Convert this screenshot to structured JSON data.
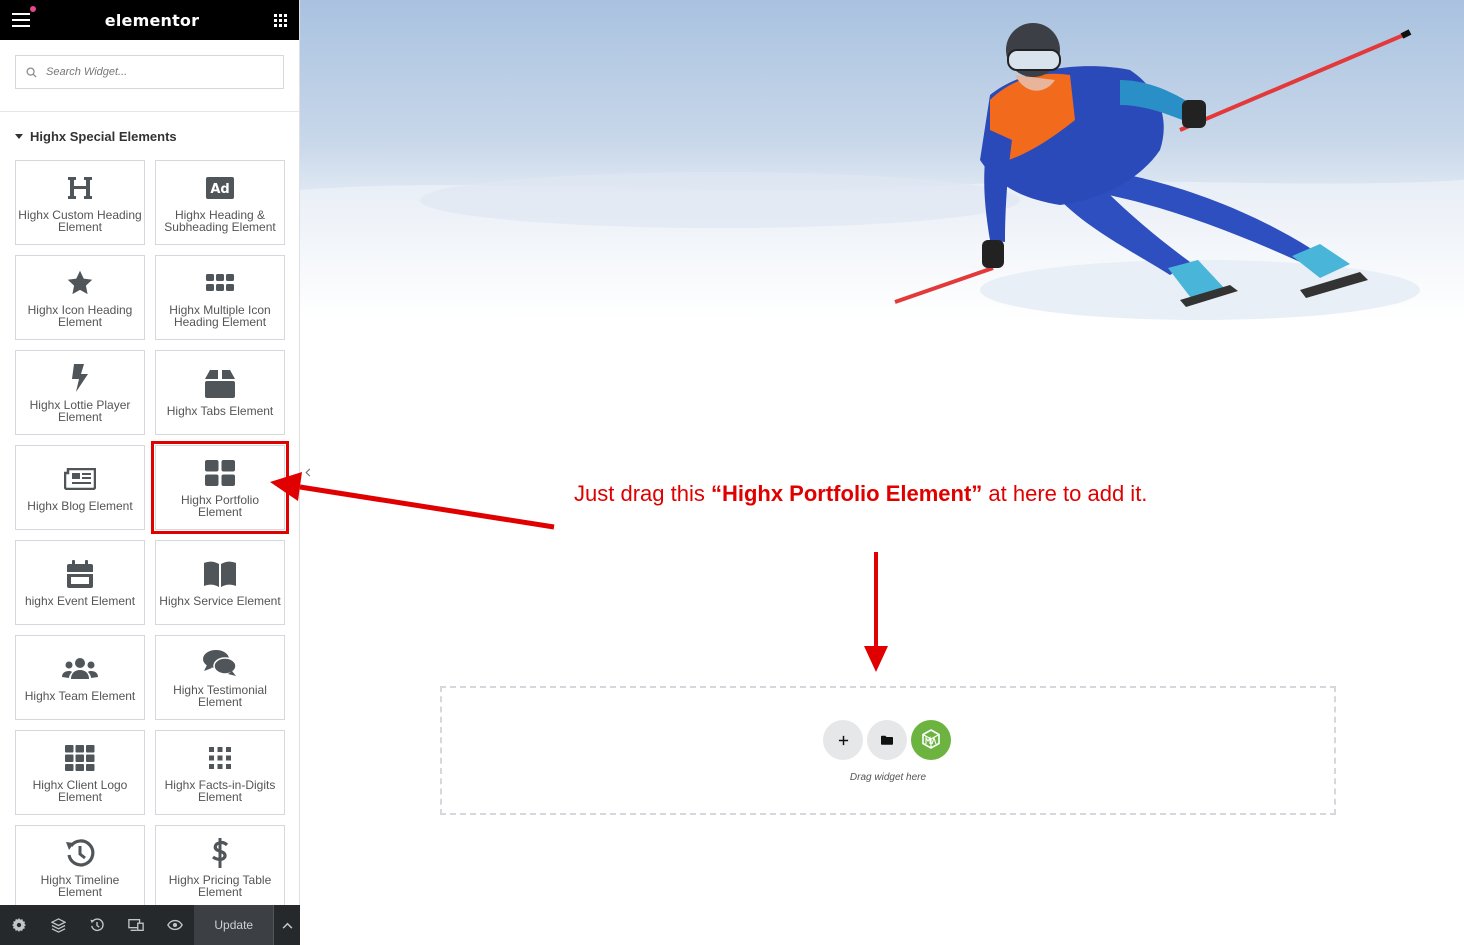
{
  "app": {
    "brand": "elementor"
  },
  "search": {
    "placeholder": "Search Widget..."
  },
  "category": {
    "title": "Highx Special Elements"
  },
  "widgets": [
    {
      "label": "Highx Custom Heading Element",
      "icon": "heading-icon"
    },
    {
      "label": "Highx Heading & Subheading Element",
      "icon": "ad-icon"
    },
    {
      "label": "Highx Icon Heading Element",
      "icon": "star-icon"
    },
    {
      "label": "Highx Multiple Icon Heading Element",
      "icon": "grid-six-icon"
    },
    {
      "label": "Highx Lottie Player Element",
      "icon": "bolt-icon"
    },
    {
      "label": "Highx Tabs Element",
      "icon": "box-icon"
    },
    {
      "label": "Highx Blog Element",
      "icon": "newspaper-icon"
    },
    {
      "label": "Highx Portfolio Element",
      "icon": "portfolio-grid-icon",
      "highlighted": true
    },
    {
      "label": "highx Event Element",
      "icon": "calendar-icon"
    },
    {
      "label": "Highx Service Element",
      "icon": "book-icon"
    },
    {
      "label": "Highx Team Element",
      "icon": "users-icon"
    },
    {
      "label": "Highx Testimonial Element",
      "icon": "comments-icon"
    },
    {
      "label": "Highx Client Logo Element",
      "icon": "grid-nine-icon"
    },
    {
      "label": "Highx Facts-in-Digits Element",
      "icon": "dots-grid-icon"
    },
    {
      "label": "Highx Timeline Element",
      "icon": "history-icon"
    },
    {
      "label": "Highx Pricing Table Element",
      "icon": "dollar-icon"
    }
  ],
  "footer": {
    "update_label": "Update"
  },
  "annotation": {
    "prefix": "Just drag this ",
    "highlight": "“Highx Portfolio Element”",
    "suffix": " at here to add it."
  },
  "dropzone": {
    "text": "Drag widget here"
  },
  "colors": {
    "accent_red": "#e00000",
    "topbar": "#000000",
    "green_button": "#6db33f",
    "bottombar": "#26292c"
  }
}
